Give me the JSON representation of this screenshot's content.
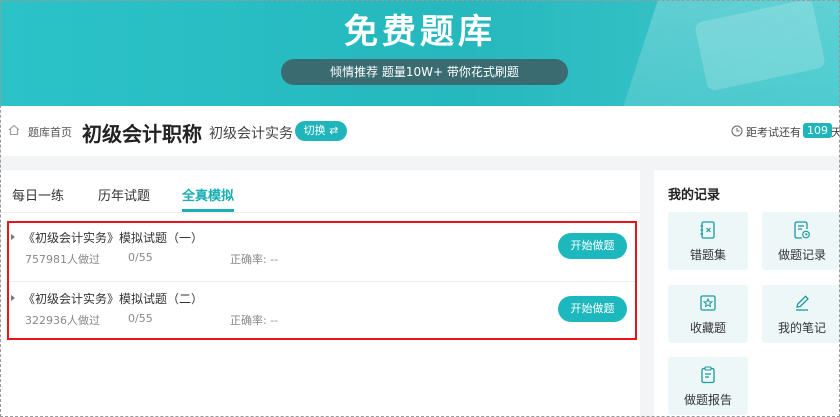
{
  "banner": {
    "title": "免费题库",
    "tagline": "倾情推荐 题量10W+ 带你花式刷题"
  },
  "header": {
    "breadcrumb": "题库首页",
    "title": "初级会计职称",
    "subject": "初级会计实务",
    "switch_label": "切换 ⇄",
    "countdown_label": "距考试还有",
    "countdown_days": "109",
    "countdown_unit": "天"
  },
  "tabs": [
    {
      "label": "每日一练"
    },
    {
      "label": "历年试题"
    },
    {
      "label": "全真模拟"
    }
  ],
  "active_tab": "全真模拟",
  "exams": [
    {
      "name": "《初级会计实务》模拟试题（一）",
      "count": "757981人做过",
      "progress": "0/55",
      "accuracy": "正确率: --",
      "button": "开始做题"
    },
    {
      "name": "《初级会计实务》模拟试题（二）",
      "count": "322936人做过",
      "progress": "0/55",
      "accuracy": "正确率: --",
      "button": "开始做题"
    }
  ],
  "records": {
    "title": "我的记录",
    "items": [
      {
        "label": "错题集",
        "icon": "error-book-icon"
      },
      {
        "label": "做题记录",
        "icon": "record-icon"
      },
      {
        "label": "收藏题",
        "icon": "star-icon"
      },
      {
        "label": "我的笔记",
        "icon": "pen-icon"
      },
      {
        "label": "做题报告",
        "icon": "report-icon"
      }
    ]
  },
  "colors": {
    "accent": "#1db8be",
    "banner": "#2bc3c8",
    "highlight_border": "#e8131b"
  }
}
